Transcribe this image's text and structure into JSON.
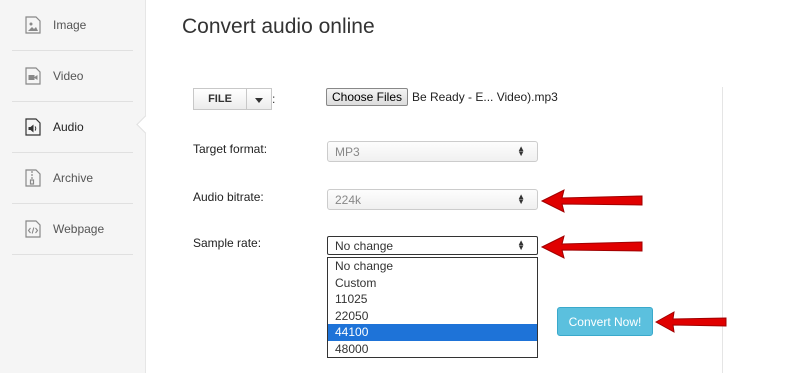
{
  "sidebar": {
    "items": [
      {
        "label": "Image",
        "icon": "image-icon"
      },
      {
        "label": "Video",
        "icon": "video-icon"
      },
      {
        "label": "Audio",
        "icon": "audio-icon",
        "active": true
      },
      {
        "label": "Archive",
        "icon": "archive-icon"
      },
      {
        "label": "Webpage",
        "icon": "webpage-icon"
      }
    ]
  },
  "main": {
    "title": "Convert audio online",
    "file": {
      "source_label": "FILE",
      "colon": ":",
      "choose_label": "Choose Files",
      "chosen_file": "Be Ready - E... Video).mp3"
    },
    "target_format": {
      "label": "Target format:",
      "value": "MP3"
    },
    "audio_bitrate": {
      "label": "Audio bitrate:",
      "value": "224k"
    },
    "sample_rate": {
      "label": "Sample rate:",
      "value": "No change",
      "options": [
        "No change",
        "Custom",
        "11025",
        "22050",
        "44100",
        "48000"
      ],
      "highlighted": "44100"
    },
    "convert_label": "Convert Now!"
  },
  "colors": {
    "accent": "#5bc0de",
    "highlight": "#1e73d8",
    "arrow": "#e00000"
  }
}
